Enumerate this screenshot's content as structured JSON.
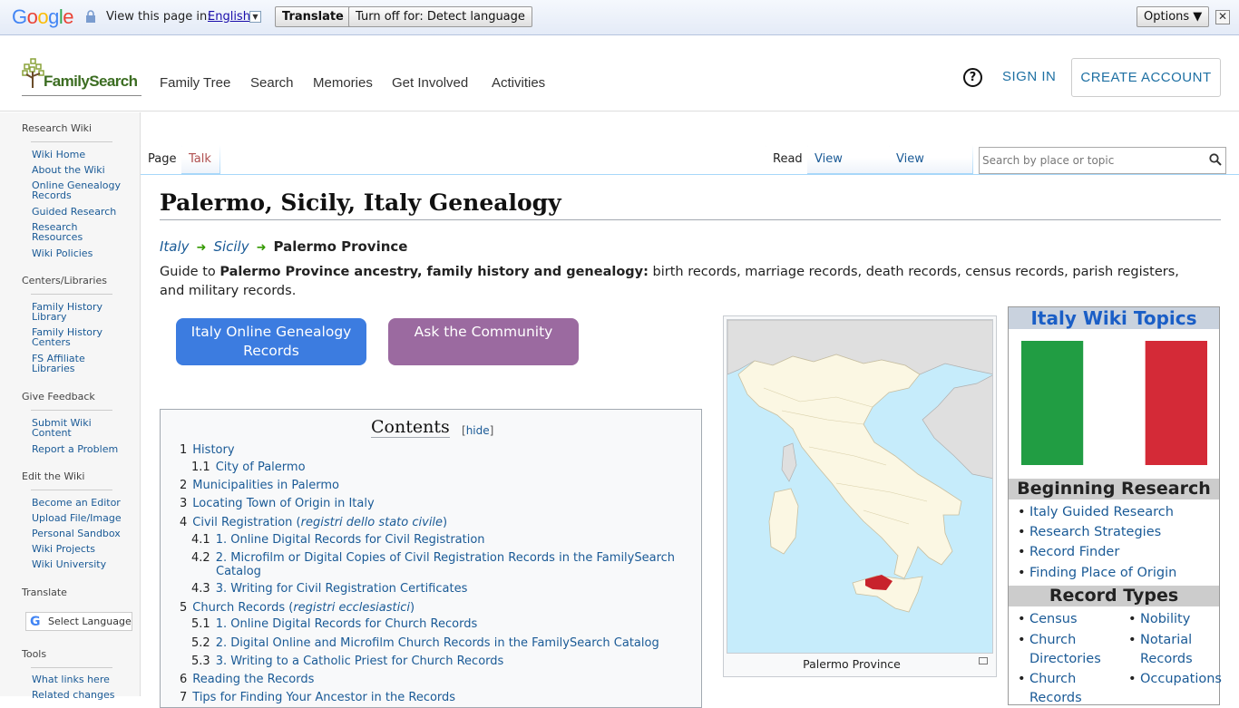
{
  "translate_bar": {
    "logo": "Google",
    "view_label": "View this page in:",
    "language": "English",
    "translate_button": "Translate",
    "turn_off_button": "Turn off for: Detect language",
    "options_button": "Options ▼",
    "close": "✕"
  },
  "header": {
    "logo_text_a": "Family",
    "logo_text_b": "Search",
    "nav": [
      "Family Tree",
      "Search",
      "Memories",
      "Get Involved",
      "Activities"
    ],
    "help": "?",
    "sign_in": "SIGN IN",
    "create_account": "CREATE ACCOUNT"
  },
  "sidebar": {
    "sections": [
      {
        "heading": "Research Wiki",
        "links": [
          "Wiki Home",
          "About the Wiki",
          "Online Genealogy Records",
          "Guided Research",
          "Research Resources",
          "Wiki Policies"
        ]
      },
      {
        "heading": "Centers/Libraries",
        "links": [
          "Family History Library",
          "Family History Centers",
          "FS Affiliate Libraries"
        ]
      },
      {
        "heading": "Give Feedback",
        "links": [
          "Submit Wiki Content",
          "Report a Problem"
        ]
      },
      {
        "heading": "Edit the Wiki",
        "links": [
          "Become an Editor",
          "Upload File/Image",
          "Personal Sandbox",
          "Wiki Projects",
          "Wiki University"
        ]
      },
      {
        "heading": "Translate",
        "links": []
      },
      {
        "heading": "Tools",
        "links": [
          "What links here",
          "Related changes"
        ]
      }
    ],
    "select_language": "Select Language"
  },
  "tabs": {
    "page": "Page",
    "talk": "Talk",
    "read": "Read",
    "view_source": "View source",
    "view_history": "View history"
  },
  "search": {
    "placeholder": "Search by place or topic"
  },
  "article": {
    "title": "Palermo, Sicily, Italy Genealogy",
    "breadcrumb": [
      "Italy",
      "Sicily",
      "Palermo Province"
    ],
    "intro_prefix": "Guide to ",
    "intro_bold": "Palermo Province ancestry, family history and genealogy:",
    "intro_rest": " birth records, marriage records, death records, census records, parish registers, and military records.",
    "button_online": "Italy Online Genealogy Records",
    "button_ask": "Ask the Community"
  },
  "toc": {
    "title": "Contents",
    "hide": "hide",
    "items": [
      {
        "num": "1",
        "text": "History"
      },
      {
        "num": "1.1",
        "text": "City of Palermo"
      },
      {
        "num": "2",
        "text": "Municipalities in Palermo"
      },
      {
        "num": "3",
        "text": "Locating Town of Origin in Italy"
      },
      {
        "num": "4",
        "text": "Civil Registration (",
        "italic": "registri dello stato civile",
        "after": ")"
      },
      {
        "num": "4.1",
        "text": "1. Online Digital Records for Civil Registration"
      },
      {
        "num": "4.2",
        "text": "2. Microfilm or Digital Copies of Civil Registration Records in the FamilySearch",
        "line2": "Catalog"
      },
      {
        "num": "4.3",
        "text": "3. Writing for Civil Registration Certificates"
      },
      {
        "num": "5",
        "text": "Church Records (",
        "italic": "registri ecclesiastici",
        "after": ")"
      },
      {
        "num": "5.1",
        "text": "1. Online Digital Records for Church Records"
      },
      {
        "num": "5.2",
        "text": "2. Digital Online and Microfilm Church Records in the FamilySearch Catalog"
      },
      {
        "num": "5.3",
        "text": "3. Writing to a Catholic Priest for Church Records"
      },
      {
        "num": "6",
        "text": "Reading the Records"
      },
      {
        "num": "7",
        "text": "Tips for Finding Your Ancestor in the Records"
      }
    ]
  },
  "map": {
    "caption": "Palermo Province"
  },
  "wiki_topics": {
    "title": "Italy Wiki Topics",
    "beginning_heading": "Beginning Research",
    "beginning_links": [
      "Italy Guided Research",
      "Research Strategies",
      "Record Finder",
      "Finding Place of Origin"
    ],
    "record_types_heading": "Record Types",
    "record_types_col1": [
      "Census",
      "Church Directories",
      "Church Records"
    ],
    "record_types_col2": [
      "Nobility",
      "Notarial Records",
      "Occupations"
    ]
  }
}
